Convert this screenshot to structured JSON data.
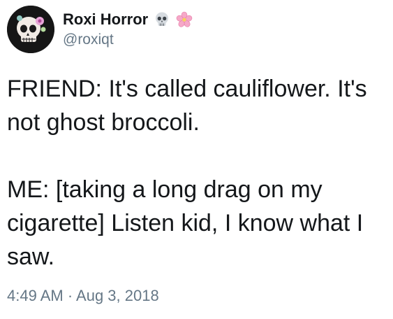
{
  "author": {
    "display_name": "Roxi Horror",
    "handle": "@roxiqt",
    "name_emojis": [
      "skull-icon",
      "cherry-blossom-icon"
    ]
  },
  "tweet": {
    "text": "FRIEND: It's called cauliflower. It's\nnot ghost broccoli.\n\nME: [taking a long drag on my\ncigarette] Listen kid, I know what I\nsaw.",
    "timestamp": "4:49 AM · Aug 3, 2018"
  },
  "colors": {
    "text": "#14171a",
    "secondary_text": "#657786",
    "background": "#ffffff"
  }
}
